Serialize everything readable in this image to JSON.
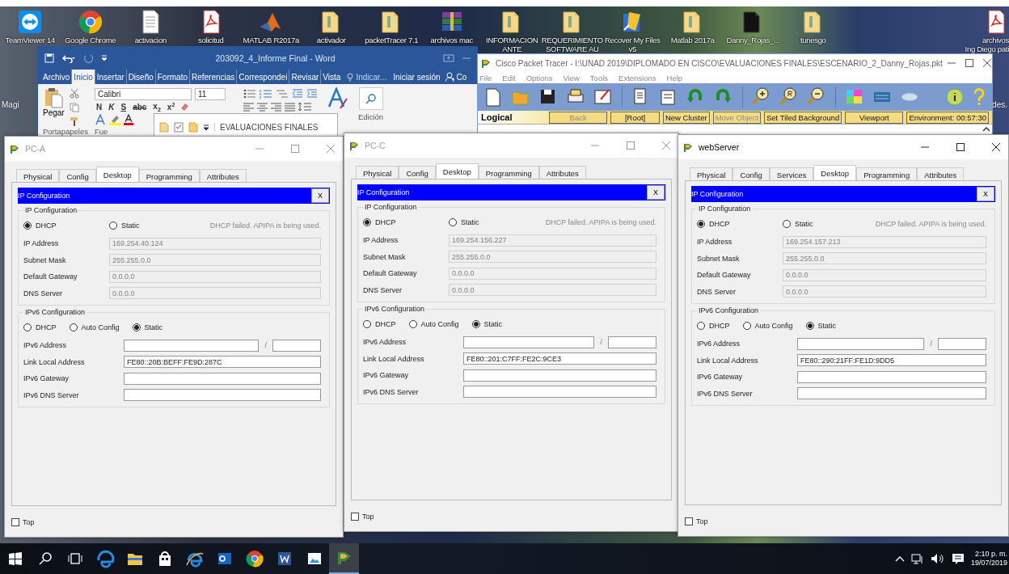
{
  "desktop": {
    "icons": [
      {
        "kind": "teamviewer",
        "lines": [
          "TeamViewer 14"
        ]
      },
      {
        "kind": "chrome",
        "lines": [
          "Google Chrome"
        ]
      },
      {
        "kind": "text",
        "lines": [
          "activacion"
        ]
      },
      {
        "kind": "pdf",
        "lines": [
          "solicitud"
        ]
      },
      {
        "kind": "matlab",
        "lines": [
          "MATLAB R2017a"
        ]
      },
      {
        "kind": "folder",
        "lines": [
          "activador"
        ]
      },
      {
        "kind": "folder",
        "lines": [
          "packetTracer 7.1"
        ]
      },
      {
        "kind": "rar",
        "lines": [
          "archivos mac"
        ]
      },
      {
        "kind": "folder",
        "lines": [
          "INFORMACION",
          "ANTE"
        ]
      },
      {
        "kind": "folder",
        "lines": [
          "REQUERIMIENTO",
          "SOFTWARE AU"
        ]
      },
      {
        "kind": "installer",
        "lines": [
          "Recover My Files",
          "v5"
        ]
      },
      {
        "kind": "folder",
        "lines": [
          "Matlab 2017a"
        ]
      },
      {
        "kind": "folder_dark",
        "lines": [
          "Danny_Rojas_..."
        ]
      },
      {
        "kind": "folder",
        "lines": [
          "tunesgo"
        ]
      },
      {
        "kind": "pdf",
        "lines": [
          "archivos",
          "Ing Diego pati"
        ]
      }
    ],
    "left_label": "Magi",
    "right_label": "des."
  },
  "word": {
    "title": "203092_4_Informe Final - Word",
    "tabs": [
      {
        "label": "Archivo",
        "selected": false
      },
      {
        "label": "Inicio",
        "selected": true
      },
      {
        "label": "Insertar",
        "selected": false
      },
      {
        "label": "Diseño",
        "selected": false
      },
      {
        "label": "Formato",
        "selected": false
      },
      {
        "label": "Referencias",
        "selected": false
      },
      {
        "label": "Correspondei",
        "selected": false
      },
      {
        "label": "Revisar",
        "selected": false
      },
      {
        "label": "Vista",
        "selected": false
      }
    ],
    "tell_me": "Indicar...",
    "sign_in": "Iniciar sesión",
    "share": "Co",
    "paste": "Pegar",
    "font_name": "Calibri",
    "font_size": "11",
    "format": [
      {
        "kind": "bold",
        "text": "N"
      },
      {
        "kind": "italic",
        "text": "K"
      },
      {
        "kind": "underline",
        "text": "S"
      },
      {
        "kind": "strike",
        "text": "abc"
      },
      {
        "kind": "plain",
        "text": "x$_{2}$"
      },
      {
        "kind": "plain",
        "text": "x$^{2}$"
      }
    ],
    "groups": [
      "Portapapeles",
      "Fue"
    ],
    "editing": "Edición"
  },
  "explorer": {
    "title": "EVALUACIONES FINALES"
  },
  "packet_tracer": {
    "title": "Cisco Packet Tracer - I:\\UNAD 2019\\DIPLOMADO EN CISCO\\EVALUACIONES FINALES\\ESCENARIO_2_Danny_Rojas.pkt",
    "menu": [
      "File",
      "Edit",
      "Options",
      "View",
      "Tools",
      "Extensions",
      "Help"
    ],
    "workspace": "Logical",
    "buttons": [
      {
        "label": "Back",
        "disabled": true
      },
      {
        "label": "[Root]",
        "disabled": false
      },
      {
        "label": "New Cluster",
        "disabled": false
      },
      {
        "label": "Move Object",
        "disabled": true
      },
      {
        "label": "Set Tiled Background",
        "disabled": false
      },
      {
        "label": "Viewport",
        "disabled": false
      },
      {
        "label": "Environment: 00:57:30",
        "disabled": false
      }
    ]
  },
  "devices": [
    {
      "title": "PC-A",
      "active": false,
      "tabs": [
        {
          "label": "Physical",
          "selected": false
        },
        {
          "label": "Config",
          "selected": false
        },
        {
          "label": "Desktop",
          "selected": true
        },
        {
          "label": "Programming",
          "selected": false
        },
        {
          "label": "Attributes",
          "selected": false
        }
      ],
      "panel_title": "IP Configuration",
      "close": "X",
      "ipv4": {
        "legend": "IP Configuration",
        "modes": [
          {
            "label": "DHCP",
            "selected": true
          },
          {
            "label": "Static",
            "selected": false
          }
        ],
        "status": "DHCP failed. APIPA is being used.",
        "fields": [
          {
            "label": "IP Address",
            "value": "169.254.40.124"
          },
          {
            "label": "Subnet Mask",
            "value": "255.255.0.0"
          },
          {
            "label": "Default Gateway",
            "value": "0.0.0.0"
          },
          {
            "label": "DNS Server",
            "value": "0.0.0.0"
          }
        ]
      },
      "ipv6": {
        "legend": "IPv6 Configuration",
        "modes": [
          {
            "label": "DHCP",
            "selected": false
          },
          {
            "label": "Auto Config",
            "selected": false
          },
          {
            "label": "Static",
            "selected": true
          }
        ],
        "fields": [
          {
            "kind": "prefixed",
            "label": "IPv6 Address",
            "separator": "/"
          },
          {
            "kind": "text",
            "label": "Link Local Address",
            "value": "FE80::20B:BEFF:FE9D:287C"
          },
          {
            "kind": "text",
            "label": "IPv6 Gateway"
          },
          {
            "kind": "text",
            "label": "IPv6 DNS Server"
          }
        ]
      },
      "top": {
        "label": "Top",
        "checked": false
      }
    },
    {
      "title": "PC-C",
      "active": false,
      "tabs": [
        {
          "label": "Physical",
          "selected": false
        },
        {
          "label": "Config",
          "selected": false
        },
        {
          "label": "Desktop",
          "selected": true
        },
        {
          "label": "Programming",
          "selected": false
        },
        {
          "label": "Attributes",
          "selected": false
        }
      ],
      "panel_title": "IP Configuration",
      "close": "X",
      "ipv4": {
        "legend": "IP Configuration",
        "modes": [
          {
            "label": "DHCP",
            "selected": true
          },
          {
            "label": "Static",
            "selected": false
          }
        ],
        "status": "DHCP failed. APIPA is being used.",
        "fields": [
          {
            "label": "IP Address",
            "value": "169.254.156.227"
          },
          {
            "label": "Subnet Mask",
            "value": "255.255.0.0"
          },
          {
            "label": "Default Gateway",
            "value": "0.0.0.0"
          },
          {
            "label": "DNS Server",
            "value": "0.0.0.0"
          }
        ]
      },
      "ipv6": {
        "legend": "IPv6 Configuration",
        "modes": [
          {
            "label": "DHCP",
            "selected": false
          },
          {
            "label": "Auto Config",
            "selected": false
          },
          {
            "label": "Static",
            "selected": true
          }
        ],
        "fields": [
          {
            "kind": "prefixed",
            "label": "IPv6 Address",
            "separator": "/"
          },
          {
            "kind": "text",
            "label": "Link Local Address",
            "value": "FE80::201:C7FF:FE2C:9CE3"
          },
          {
            "kind": "text",
            "label": "IPv6 Gateway"
          },
          {
            "kind": "text",
            "label": "IPv6 DNS Server"
          }
        ]
      },
      "top": {
        "label": "Top",
        "checked": false
      }
    },
    {
      "title": "webServer",
      "active": true,
      "tabs": [
        {
          "label": "Physical",
          "selected": false
        },
        {
          "label": "Config",
          "selected": false
        },
        {
          "label": "Services",
          "selected": false
        },
        {
          "label": "Desktop",
          "selected": true
        },
        {
          "label": "Programming",
          "selected": false
        },
        {
          "label": "Attributes",
          "selected": false
        }
      ],
      "panel_title": "IP Configuration",
      "close": "X",
      "ipv4": {
        "legend": "IP Configuration",
        "modes": [
          {
            "label": "DHCP",
            "selected": true
          },
          {
            "label": "Static",
            "selected": false
          }
        ],
        "status": "DHCP failed. APIPA is being used.",
        "fields": [
          {
            "label": "IP Address",
            "value": "169.254.157.213"
          },
          {
            "label": "Subnet Mask",
            "value": "255.255.0.0"
          },
          {
            "label": "Default Gateway",
            "value": "0.0.0.0"
          },
          {
            "label": "DNS Server",
            "value": "0.0.0.0"
          }
        ]
      },
      "ipv6": {
        "legend": "IPv6 Configuration",
        "modes": [
          {
            "label": "DHCP",
            "selected": false
          },
          {
            "label": "Auto Config",
            "selected": false
          },
          {
            "label": "Static",
            "selected": true
          }
        ],
        "fields": [
          {
            "kind": "prefixed",
            "label": "IPv6 Address",
            "separator": "/"
          },
          {
            "kind": "text",
            "label": "Link Local Address",
            "value": "FE80::290:21FF:FE1D:9DD5"
          },
          {
            "kind": "text",
            "label": "IPv6 Gateway"
          },
          {
            "kind": "text",
            "label": "IPv6 DNS Server"
          }
        ]
      },
      "top": {
        "label": "Top",
        "checked": false
      }
    }
  ],
  "taskbar": {
    "apps": [
      {
        "kind": "edge",
        "active": false
      },
      {
        "kind": "explorer",
        "active": false
      },
      {
        "kind": "store",
        "active": false
      },
      {
        "kind": "ie",
        "active": false
      },
      {
        "kind": "outlook",
        "active": false
      },
      {
        "kind": "chrome",
        "active": false
      },
      {
        "kind": "word",
        "active": false
      },
      {
        "kind": "photos",
        "active": false
      },
      {
        "kind": "packettracer",
        "active": true
      }
    ],
    "time": "2:10 p. m.",
    "date": "19/07/2019"
  }
}
